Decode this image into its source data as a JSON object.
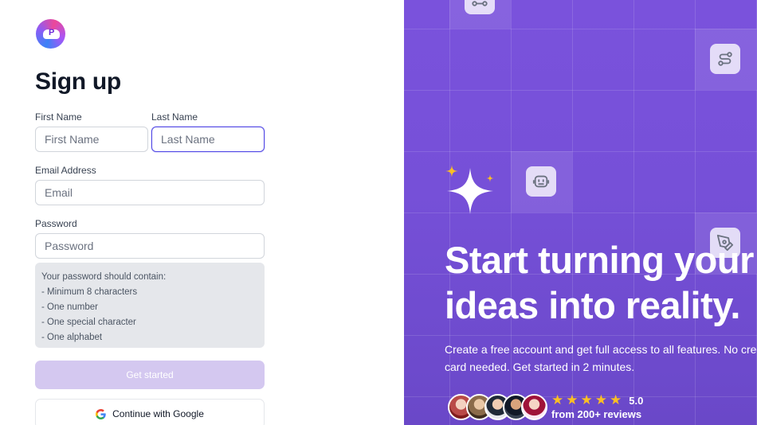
{
  "form": {
    "title": "Sign up",
    "first_name": {
      "label": "First Name",
      "placeholder": "First Name"
    },
    "last_name": {
      "label": "Last Name",
      "placeholder": "Last Name"
    },
    "email": {
      "label": "Email Address",
      "placeholder": "Email"
    },
    "password": {
      "label": "Password",
      "placeholder": "Password"
    },
    "password_hint": {
      "intro": "Your password should contain:",
      "rules": [
        "- Minimum 8 characters",
        "- One number",
        "- One special character",
        "- One alphabet"
      ]
    },
    "submit_label": "Get started",
    "google_label": "Continue with Google"
  },
  "promo": {
    "headline_line1": "Start turning your",
    "headline_line2": "ideas into reality.",
    "sub_line1": "Create a free account and get full access to all features. No credit",
    "sub_line2": "card needed. Get started in 2 minutes.",
    "rating_value": "5.0",
    "rating_stars": 5,
    "reviews_text": "from 200+ reviews"
  },
  "colors": {
    "brand_purple": "#7a52dc",
    "button_disabled": "#d4c8f0",
    "focus_border": "#4f46e5",
    "star": "#fbbf24"
  },
  "icons": {
    "logo": "cloud-logo-icon",
    "google": "google-icon",
    "tile_top": "connector-icon",
    "tile_route": "route-icon",
    "tile_robot": "robot-icon",
    "tile_pen": "pen-tool-icon",
    "sparkle": "sparkle-icon"
  }
}
